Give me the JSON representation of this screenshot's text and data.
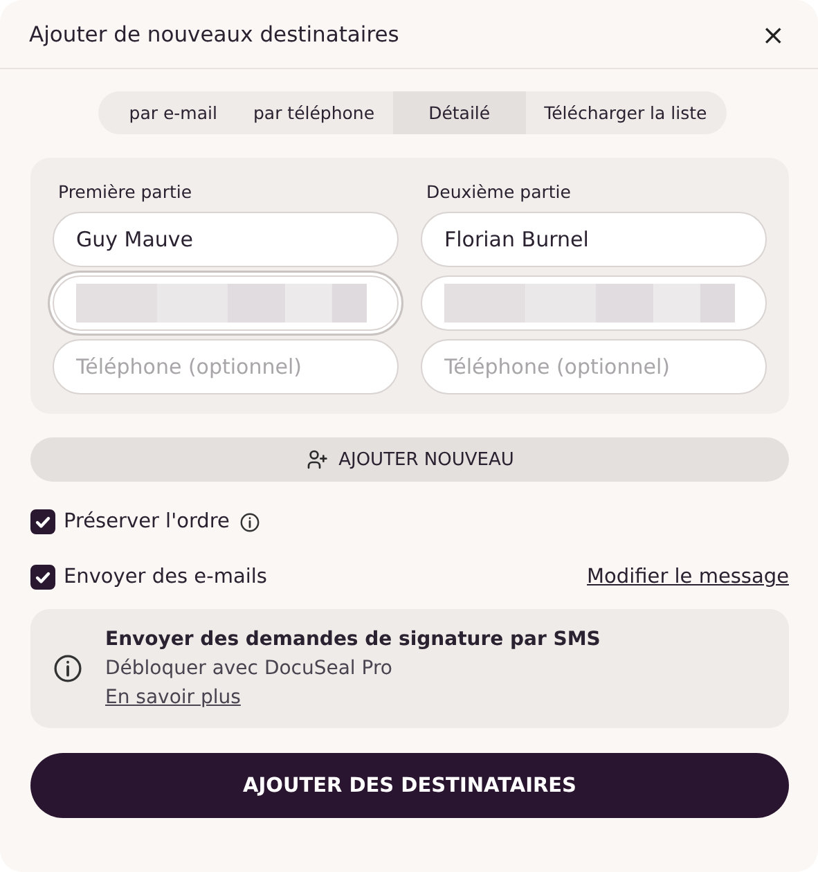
{
  "dialog": {
    "title": "Ajouter de nouveaux destinataires",
    "close": "×"
  },
  "tabs": [
    {
      "label": "par e-mail",
      "selected": false
    },
    {
      "label": "par téléphone",
      "selected": false
    },
    {
      "label": "Détailé",
      "selected": true
    },
    {
      "label": "Télécharger la liste",
      "selected": false
    }
  ],
  "parties": [
    {
      "label": "Première partie",
      "fields": [
        {
          "kind": "value",
          "value": "Guy Mauve",
          "focused": false
        },
        {
          "kind": "redacted",
          "focused": true
        },
        {
          "kind": "empty",
          "placeholder": "Téléphone (optionnel)",
          "focused": false
        }
      ]
    },
    {
      "label": "Deuxième partie",
      "fields": [
        {
          "kind": "value",
          "value": "Florian Burnel",
          "focused": false
        },
        {
          "kind": "redacted",
          "focused": false
        },
        {
          "kind": "empty",
          "placeholder": "Téléphone (optionnel)",
          "focused": false
        }
      ]
    }
  ],
  "add_button": "AJOUTER NOUVEAU",
  "options": [
    {
      "label": "Préserver l'ordre",
      "checked": true,
      "info": true
    },
    {
      "label": "Envoyer des e-mails",
      "checked": true,
      "info": false,
      "link": "Modifier le message"
    }
  ],
  "notice": {
    "title": "Envoyer des demandes de signature par SMS",
    "text": "Débloquer avec DocuSeal Pro",
    "link": "En savoir plus"
  },
  "submit": "AJOUTER DES DESTINATAIRES"
}
